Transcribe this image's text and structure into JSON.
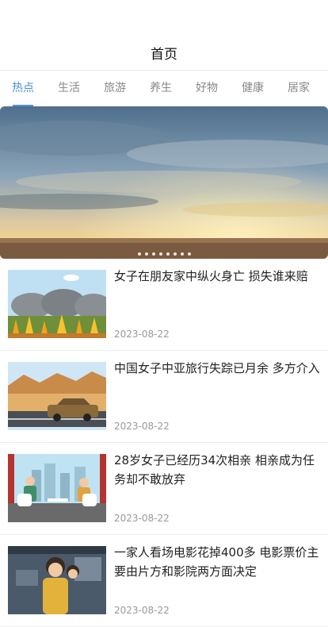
{
  "header": {
    "title": "首页"
  },
  "tabs": [
    {
      "label": "热点",
      "active": true
    },
    {
      "label": "生活",
      "active": false
    },
    {
      "label": "旅游",
      "active": false
    },
    {
      "label": "养生",
      "active": false
    },
    {
      "label": "好物",
      "active": false
    },
    {
      "label": "健康",
      "active": false
    },
    {
      "label": "居家",
      "active": false
    }
  ],
  "banner": {
    "slide_count": 8
  },
  "colors": {
    "accent": "#4a90e2",
    "text": "#222222",
    "muted": "#999999"
  },
  "articles": [
    {
      "title": "女子在朋友家中纵火身亡 损失谁来赔",
      "date": "2023-08-22",
      "thumb": "fire-illustration"
    },
    {
      "title": "中国女子中亚旅行失踪已月余 多方介入",
      "date": "2023-08-22",
      "thumb": "desert-car-illustration"
    },
    {
      "title": "28岁女子已经历34次相亲 相亲成为任务却不敢放弃",
      "date": "2023-08-22",
      "thumb": "date-cafe-illustration"
    },
    {
      "title": "一家人看场电影花掉400多 电影票价主要由片方和影院两方面决定",
      "date": "2023-08-22",
      "thumb": "cinema-illustration"
    }
  ]
}
